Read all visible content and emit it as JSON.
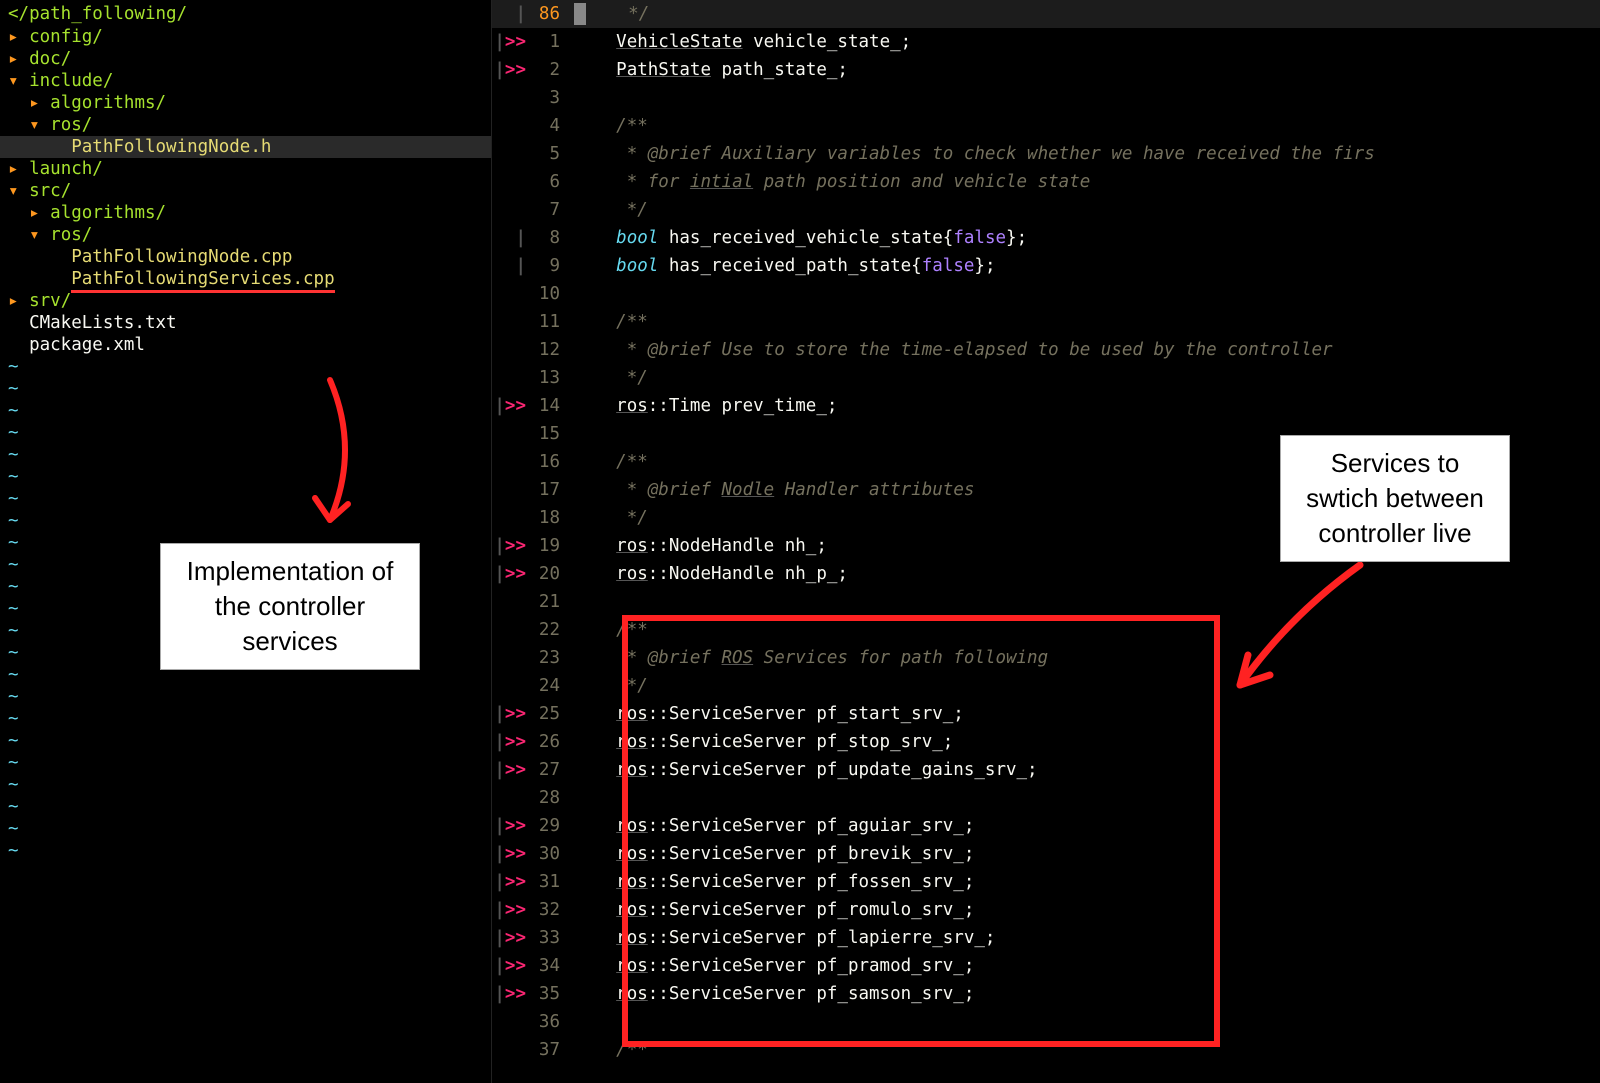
{
  "sidebar": {
    "header": "</path_following/",
    "items": [
      {
        "indent": 0,
        "caret": "right",
        "name": "config/",
        "kind": "dir"
      },
      {
        "indent": 0,
        "caret": "right",
        "name": "doc/",
        "kind": "dir"
      },
      {
        "indent": 0,
        "caret": "down",
        "name": "include/",
        "kind": "dir"
      },
      {
        "indent": 1,
        "caret": "right",
        "name": "algorithms/",
        "kind": "dir"
      },
      {
        "indent": 1,
        "caret": "down",
        "name": "ros/",
        "kind": "dir"
      },
      {
        "indent": 2,
        "caret": "",
        "name": "PathFollowingNode.h",
        "kind": "file-y",
        "selected": true
      },
      {
        "indent": 0,
        "caret": "right",
        "name": "launch/",
        "kind": "dir"
      },
      {
        "indent": 0,
        "caret": "down",
        "name": "src/",
        "kind": "dir"
      },
      {
        "indent": 1,
        "caret": "right",
        "name": "algorithms/",
        "kind": "dir"
      },
      {
        "indent": 1,
        "caret": "down",
        "name": "ros/",
        "kind": "dir"
      },
      {
        "indent": 2,
        "caret": "",
        "name": "PathFollowingNode.cpp",
        "kind": "file-y"
      },
      {
        "indent": 2,
        "caret": "",
        "name": "PathFollowingServices.cpp",
        "kind": "file-y",
        "underline": true
      },
      {
        "indent": 0,
        "caret": "right",
        "name": "srv/",
        "kind": "dir"
      },
      {
        "indent": 0,
        "caret": "",
        "name": "CMakeLists.txt",
        "kind": "file"
      },
      {
        "indent": 0,
        "caret": "",
        "name": "package.xml",
        "kind": "file"
      }
    ]
  },
  "editor": {
    "absolute_line": "86",
    "lines": [
      {
        "n": "86",
        "sign": "|",
        "abs": true,
        "html": "    <span class='c-comment'>*/</span>"
      },
      {
        "n": "1",
        "sign": "|>>",
        "html": "    <span class='c-type-u'>VehicleState</span> <span class='c-ident'>vehicle_state_;</span>"
      },
      {
        "n": "2",
        "sign": "|>>",
        "html": "    <span class='c-type-u'>PathState</span> <span class='c-ident'>path_state_;</span>"
      },
      {
        "n": "3",
        "sign": "",
        "html": ""
      },
      {
        "n": "4",
        "sign": "",
        "html": "    <span class='c-comment'>/**</span>"
      },
      {
        "n": "5",
        "sign": "",
        "html": "    <span class='c-comment'> * @brief Auxiliary variables to check whether we have received the firs</span>"
      },
      {
        "n": "6",
        "sign": "",
        "html": "    <span class='c-comment'> * for <span class='c-u'>intial</span> path position and vehicle state</span>"
      },
      {
        "n": "7",
        "sign": "",
        "html": "    <span class='c-comment'> */</span>"
      },
      {
        "n": "8",
        "sign": "|",
        "html": "    <span class='c-type'>bool</span> <span class='c-ident'>has_received_vehicle_state{</span><span class='c-bool'>false</span><span class='c-ident'>};</span>"
      },
      {
        "n": "9",
        "sign": "|",
        "html": "    <span class='c-type'>bool</span> <span class='c-ident'>has_received_path_state{</span><span class='c-bool'>false</span><span class='c-ident'>};</span>"
      },
      {
        "n": "10",
        "sign": "",
        "html": ""
      },
      {
        "n": "11",
        "sign": "",
        "html": "    <span class='c-comment'>/**</span>"
      },
      {
        "n": "12",
        "sign": "",
        "html": "    <span class='c-comment'> * @brief Use to store the time-elapsed to be used by the controller</span>"
      },
      {
        "n": "13",
        "sign": "",
        "html": "    <span class='c-comment'> */</span>"
      },
      {
        "n": "14",
        "sign": "|>>",
        "html": "    <span class='c-ns'>ros</span><span class='c-ident'>::Time prev_time_;</span>"
      },
      {
        "n": "15",
        "sign": "",
        "html": ""
      },
      {
        "n": "16",
        "sign": "",
        "html": "    <span class='c-comment'>/**</span>"
      },
      {
        "n": "17",
        "sign": "",
        "html": "    <span class='c-comment'> * @brief <span class='c-u'>Nodle</span> Handler attributes</span>"
      },
      {
        "n": "18",
        "sign": "",
        "html": "    <span class='c-comment'> */</span>"
      },
      {
        "n": "19",
        "sign": "|>>",
        "html": "    <span class='c-ns'>ros</span><span class='c-ident'>::NodeHandle nh_;</span>"
      },
      {
        "n": "20",
        "sign": "|>>",
        "html": "    <span class='c-ns'>ros</span><span class='c-ident'>::NodeHandle nh_p_;</span>"
      },
      {
        "n": "21",
        "sign": "",
        "html": ""
      },
      {
        "n": "22",
        "sign": "",
        "html": "    <span class='c-comment'>/**</span>"
      },
      {
        "n": "23",
        "sign": "",
        "html": "    <span class='c-comment'> * @brief <span class='c-u'>ROS</span> Services for path following</span>"
      },
      {
        "n": "24",
        "sign": "",
        "html": "    <span class='c-comment'> */</span>"
      },
      {
        "n": "25",
        "sign": "|>>",
        "html": "    <span class='c-ns'>ros</span><span class='c-ident'>::ServiceServer pf_start_srv_;</span>"
      },
      {
        "n": "26",
        "sign": "|>>",
        "html": "    <span class='c-ns'>ros</span><span class='c-ident'>::ServiceServer pf_stop_srv_;</span>"
      },
      {
        "n": "27",
        "sign": "|>>",
        "html": "    <span class='c-ns'>ros</span><span class='c-ident'>::ServiceServer pf_update_gains_srv_;</span>"
      },
      {
        "n": "28",
        "sign": "",
        "html": ""
      },
      {
        "n": "29",
        "sign": "|>>",
        "html": "    <span class='c-ns'>ros</span><span class='c-ident'>::ServiceServer pf_aguiar_srv_;</span>"
      },
      {
        "n": "30",
        "sign": "|>>",
        "html": "    <span class='c-ns'>ros</span><span class='c-ident'>::ServiceServer pf_brevik_srv_;</span>"
      },
      {
        "n": "31",
        "sign": "|>>",
        "html": "    <span class='c-ns'>ros</span><span class='c-ident'>::ServiceServer pf_fossen_srv_;</span>"
      },
      {
        "n": "32",
        "sign": "|>>",
        "html": "    <span class='c-ns'>ros</span><span class='c-ident'>::ServiceServer pf_romulo_srv_;</span>"
      },
      {
        "n": "33",
        "sign": "|>>",
        "html": "    <span class='c-ns'>ros</span><span class='c-ident'>::ServiceServer pf_lapierre_srv_;</span>"
      },
      {
        "n": "34",
        "sign": "|>>",
        "html": "    <span class='c-ns'>ros</span><span class='c-ident'>::ServiceServer pf_pramod_srv_;</span>"
      },
      {
        "n": "35",
        "sign": "|>>",
        "html": "    <span class='c-ns'>ros</span><span class='c-ident'>::ServiceServer pf_samson_srv_;</span>"
      },
      {
        "n": "36",
        "sign": "",
        "html": ""
      },
      {
        "n": "37",
        "sign": "",
        "html": "    <span class='c-comment'>/**</span>"
      }
    ]
  },
  "annotations": {
    "left": "Implementation of the controller services",
    "right": "Services to swtich between controller live"
  }
}
